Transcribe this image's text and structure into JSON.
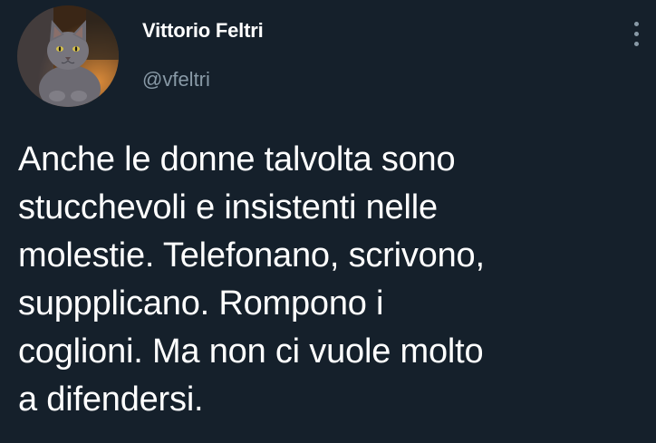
{
  "author": {
    "display_name": "Vittorio Feltri",
    "handle": "@vfeltri",
    "avatar_icon": "cat-avatar-icon"
  },
  "menu": {
    "icon": "more-vertical-icon"
  },
  "tweet": {
    "lines": [
      "Anche le donne talvolta sono",
      "stucchevoli e insistenti nelle",
      "molestie. Telefonano, scrivono,",
      "suppplicano. Rompono i",
      "coglioni. Ma non ci vuole molto",
      "a difendersi."
    ]
  },
  "colors": {
    "background": "#15202b",
    "text_primary": "#ffffff",
    "text_secondary": "#8899a6"
  }
}
